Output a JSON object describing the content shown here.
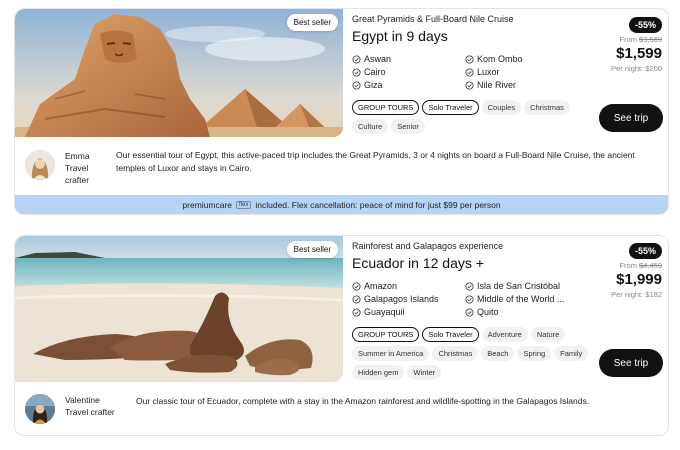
{
  "tours": [
    {
      "badge": "Best seller",
      "subtitle": "Great Pyramids & Full-Board Nile Cruise",
      "title": "Egypt in 9 days",
      "destinations": [
        "Aswan",
        "Kom Ombo",
        "Cairo",
        "Luxor",
        "Giza",
        "Nile River"
      ],
      "tags_outlined": [
        "GROUP TOURS",
        "Solo Traveler"
      ],
      "tags": [
        "Couples",
        "Christmas",
        "Culture",
        "Senior"
      ],
      "discount": "-55%",
      "from_label": "From",
      "old_price": "$3,569",
      "price": "$1,599",
      "per_night": "Per night: $200",
      "cta": "See trip",
      "crafter_name": "Emma",
      "crafter_role": "Travel crafter",
      "description": "Our essential tour of Egypt, this active-paced trip includes the Great Pyramids, 3 or 4 nights on board a Full-Board Nile Cruise, the ancient temples of Luxor and stays in Cairo.",
      "premium": {
        "brand": "premiumcare",
        "chip": "flex",
        "text": "included. Flex cancellation: peace of mind for just $99 per person"
      }
    },
    {
      "badge": "Best seller",
      "subtitle": "Rainforest and Galapagos experience",
      "title": "Ecuador in 12 days +",
      "destinations": [
        "Amazon",
        "Isla de San Cristóbal",
        "Galapagos Islands",
        "Middle of the World ...",
        "Guayaquil",
        "Quito"
      ],
      "tags_outlined": [
        "GROUP TOURS",
        "Solo Traveler"
      ],
      "tags": [
        "Adventure",
        "Nature",
        "Summer in America",
        "Christmas",
        "Beach",
        "Spring",
        "Family",
        "Hidden gem",
        "Winter"
      ],
      "discount": "-55%",
      "from_label": "From",
      "old_price": "$4,459",
      "price": "$1,999",
      "per_night": "Per night: $182",
      "cta": "See trip",
      "crafter_name": "Valentine",
      "crafter_role": "Travel crafter",
      "description": "Our classic tour of Ecuador, complete with a stay in the Amazon rainforest and wildlife-spotting in the Galapagos Islands."
    }
  ],
  "icons": {
    "destination": "location-check-icon"
  }
}
